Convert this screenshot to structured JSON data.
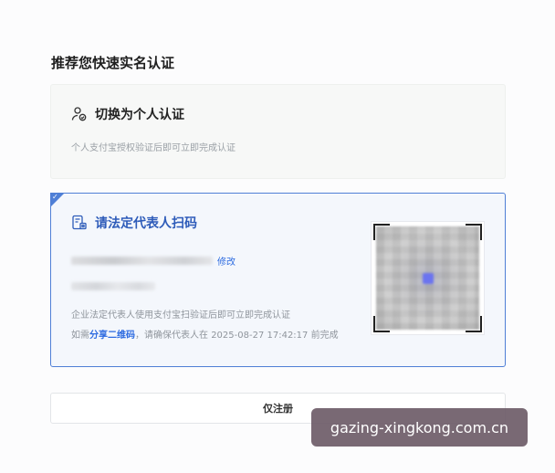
{
  "page": {
    "title": "推荐您快速实名认证"
  },
  "personal_card": {
    "icon": "person-verify-icon",
    "title": "切换为个人认证",
    "description": "个人支付宝授权验证后即可立即完成认证"
  },
  "legal_card": {
    "icon": "qr-document-icon",
    "title": "请法定代表人扫码",
    "selected": true,
    "edit_label": "修改",
    "description": "企业法定代表人使用支付宝扫验证后即可立即完成认证",
    "hint_prefix": "如需",
    "share_label": "分享二维码",
    "hint_middle": "，请确保代表人在",
    "deadline": "2025-08-27 17:42:17",
    "hint_suffix": "前完成"
  },
  "register_button": {
    "label": "仅注册"
  },
  "watermark": {
    "text": "gazing-xingkong.com.cn"
  },
  "colors": {
    "accent": "#4f7fd6",
    "link": "#2d6be0",
    "muted": "#9aa0a6"
  }
}
